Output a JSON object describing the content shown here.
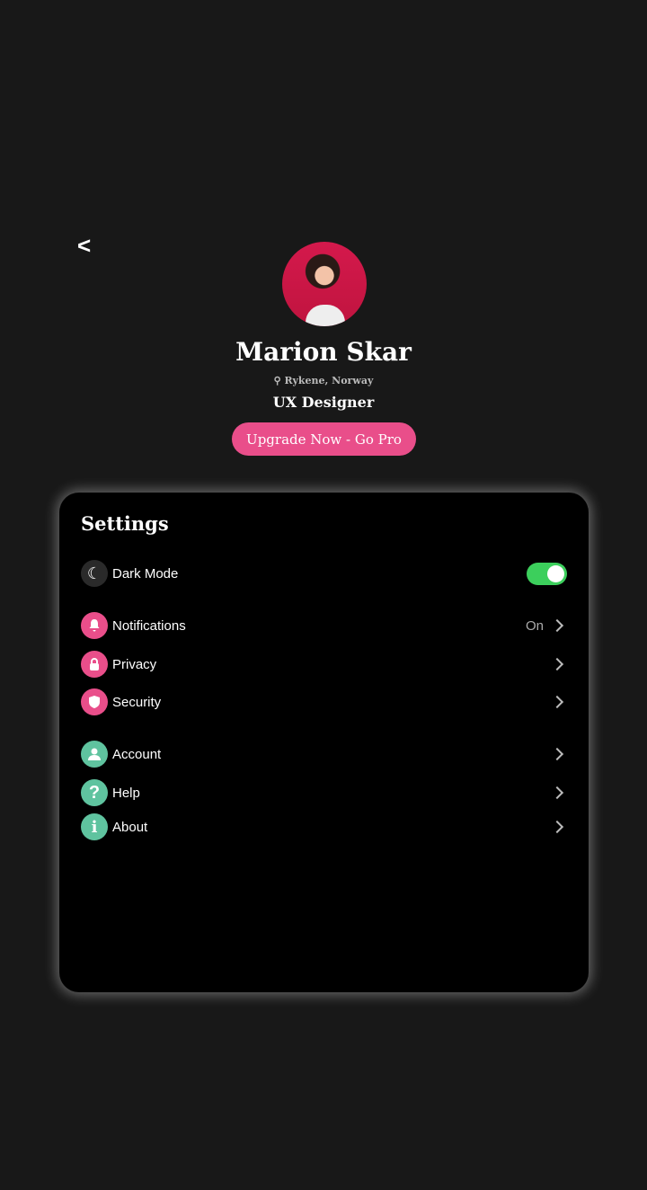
{
  "header": {
    "back_label": "<"
  },
  "profile": {
    "name": "Marion Skar",
    "location": "Rykene, Norway",
    "role": "UX Designer",
    "upgrade_label": "Upgrade Now - Go Pro"
  },
  "settings": {
    "title": "Settings",
    "dark_mode": {
      "label": "Dark Mode",
      "enabled": true
    },
    "items": [
      {
        "label": "Notifications",
        "value": "On",
        "icon": "bell-icon"
      },
      {
        "label": "Privacy",
        "icon": "lock-icon"
      },
      {
        "label": "Security",
        "icon": "shield-icon"
      },
      {
        "label": "Account",
        "icon": "user-icon"
      },
      {
        "label": "Help",
        "icon": "help-icon"
      },
      {
        "label": "About",
        "icon": "info-icon"
      }
    ]
  },
  "colors": {
    "accent": "#e94e8a",
    "secondary": "#5fc39f",
    "toggle_on": "#3ccf5c",
    "background": "#181818"
  }
}
